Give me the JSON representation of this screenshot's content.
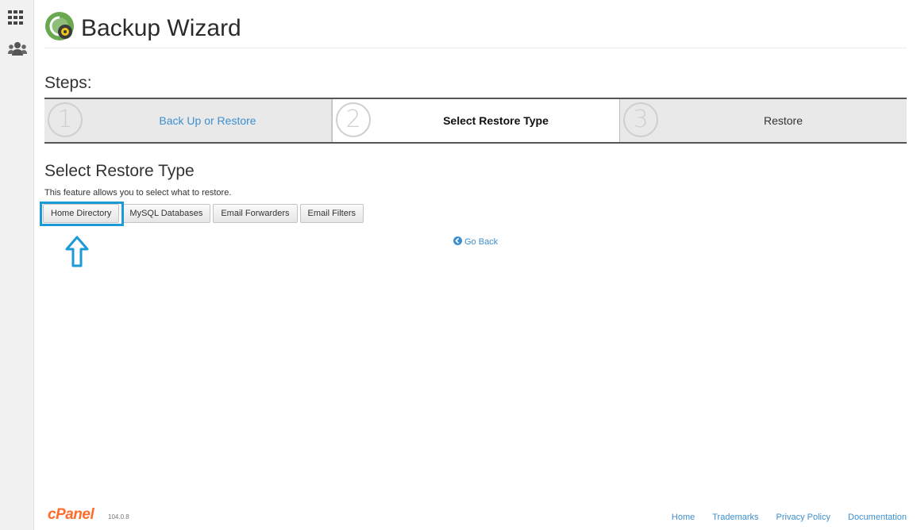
{
  "page": {
    "title": "Backup Wizard"
  },
  "steps": {
    "heading": "Steps:",
    "items": [
      {
        "number": "1",
        "label": "Back Up or Restore"
      },
      {
        "number": "2",
        "label": "Select Restore Type"
      },
      {
        "number": "3",
        "label": "Restore"
      }
    ],
    "active_index": 2
  },
  "section": {
    "title": "Select Restore Type",
    "description": "This feature allows you to select what to restore."
  },
  "restore_buttons": [
    "Home Directory",
    "MySQL Databases",
    "Email Forwarders",
    "Email Filters"
  ],
  "go_back": "Go Back",
  "footer": {
    "brand": "cPanel",
    "version": "104.0.8",
    "links": [
      "Home",
      "Trademarks",
      "Privacy Policy",
      "Documentation"
    ]
  },
  "colors": {
    "link": "#3d8fcf",
    "highlight": "#1b9ad6",
    "brand": "#ff6c2c"
  },
  "icons": {
    "sidebar": [
      "apps-grid-icon",
      "users-icon"
    ],
    "logo": "backup-wizard-icon",
    "go_back": "arrow-circle-left-icon",
    "annotation": "arrow-up-icon"
  }
}
